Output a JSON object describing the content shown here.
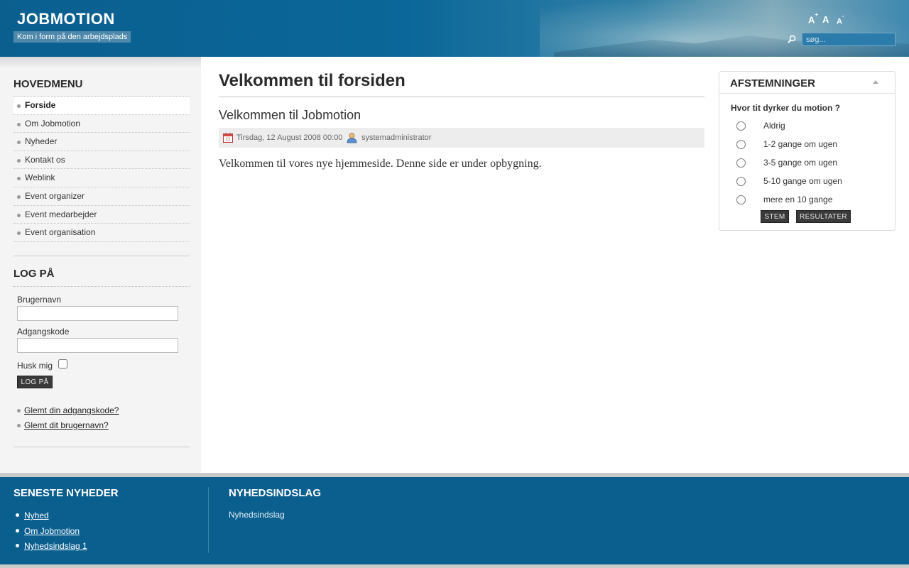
{
  "header": {
    "site_title": "JOBMOTION",
    "slogan": "Kom i form på den arbejdsplads",
    "font_controls": {
      "increase": "A",
      "increase_sup": "+",
      "reset": "A",
      "decrease": "A",
      "decrease_sup": "-"
    },
    "search": {
      "placeholder": "søg..."
    }
  },
  "main_menu": {
    "title": "HOVEDMENU",
    "items": [
      {
        "label": "Forside",
        "active": true
      },
      {
        "label": "Om Jobmotion"
      },
      {
        "label": "Nyheder"
      },
      {
        "label": "Kontakt os"
      },
      {
        "label": "Weblink"
      },
      {
        "label": "Event organizer"
      },
      {
        "label": "Event medarbejder"
      },
      {
        "label": "Event organisation"
      }
    ]
  },
  "login": {
    "title": "LOG PÅ",
    "username_label": "Brugernavn",
    "password_label": "Adgangskode",
    "remember_label": "Husk mig",
    "submit_label": "LOG PÅ",
    "forgot_password": "Glemt din adgangskode?",
    "forgot_username": "Glemt dit brugernavn?"
  },
  "content": {
    "page_heading": "Velkommen til forsiden",
    "article_title": "Velkommen til Jobmotion",
    "date": "Tirsdag, 12 August 2008 00:00",
    "author": "systemadministrator",
    "body": "Velkommen til vores nye hjemmeside. Denne side er under opbygning."
  },
  "poll": {
    "title": "AFSTEMNINGER",
    "question": "Hvor tit dyrker du motion ?",
    "options": [
      "Aldrig",
      "1-2 gange om ugen",
      "3-5 gange om ugen",
      "5-10 gange om ugen",
      "mere en 10 gange"
    ],
    "vote_label": "STEM",
    "results_label": "RESULTATER"
  },
  "footer": {
    "latest_news_title": "SENESTE NYHEDER",
    "latest_news": [
      "Nyhed",
      "Om Jobmotion",
      "Nyhedsindslag 1"
    ],
    "newsflash_title": "NYHEDSINDSLAG",
    "newsflash_text": "Nyhedsindslag"
  },
  "colors": {
    "brand_blue": "#0a5f8f",
    "button_dark": "#3a3a3a",
    "sidebar_bg": "#f4f4f4"
  }
}
